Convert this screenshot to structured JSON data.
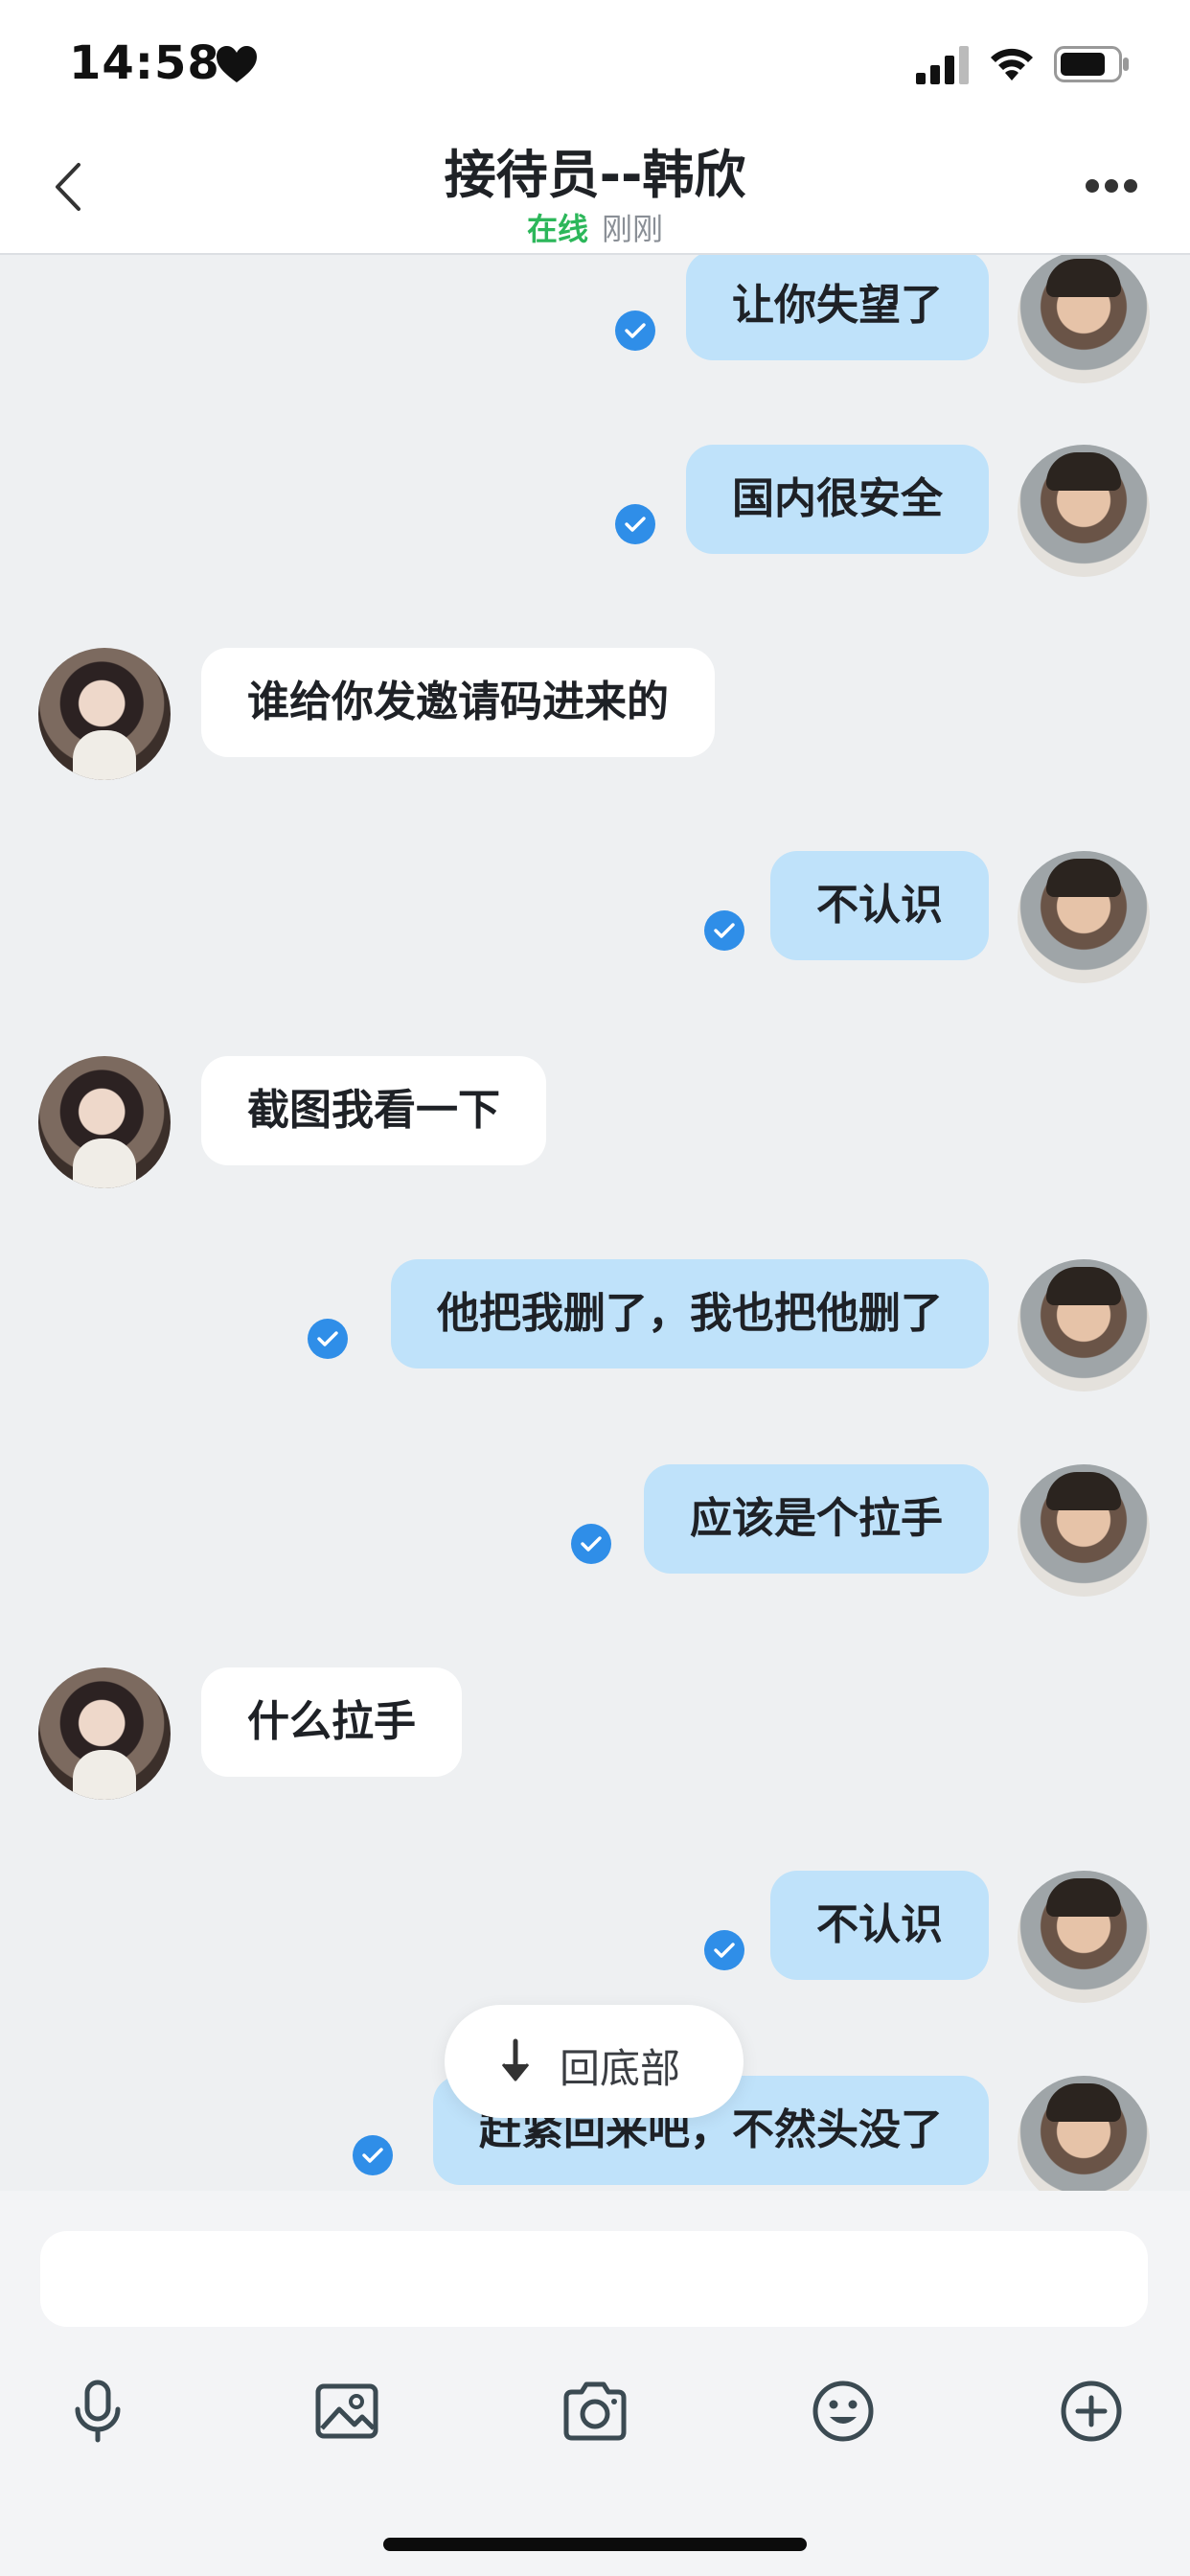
{
  "status": {
    "time": "14:58"
  },
  "header": {
    "title": "接待员--韩欣",
    "online": "在线",
    "last_seen": "刚刚"
  },
  "messages": [
    {
      "side": "right",
      "text": "让你失望了",
      "read": true
    },
    {
      "side": "right",
      "text": "国内很安全",
      "read": true
    },
    {
      "side": "left",
      "text": "谁给你发邀请码进来的"
    },
    {
      "side": "right",
      "text": "不认识",
      "read": true
    },
    {
      "side": "left",
      "text": "截图我看一下"
    },
    {
      "side": "right",
      "text": "他把我删了，我也把他删了",
      "read": true
    },
    {
      "side": "right",
      "text": "应该是个拉手",
      "read": true
    },
    {
      "side": "left",
      "text": "什么拉手"
    },
    {
      "side": "right",
      "text": "不认识",
      "read": true
    },
    {
      "side": "right",
      "text": "赶紧回来吧，不然头没了",
      "read": true
    }
  ],
  "scroll_to_bottom": {
    "label": "回底部"
  },
  "composer": {
    "placeholder": "",
    "value": ""
  },
  "toolbar": {
    "icons": [
      "microphone-icon",
      "image-icon",
      "camera-icon",
      "emoji-icon",
      "plus-icon"
    ]
  },
  "colors": {
    "accent": "#2f8ee8",
    "online": "#2cb75a",
    "outgoing_bubble": "#bfe2fa",
    "incoming_bubble": "#ffffff",
    "background": "#eef0f2"
  }
}
